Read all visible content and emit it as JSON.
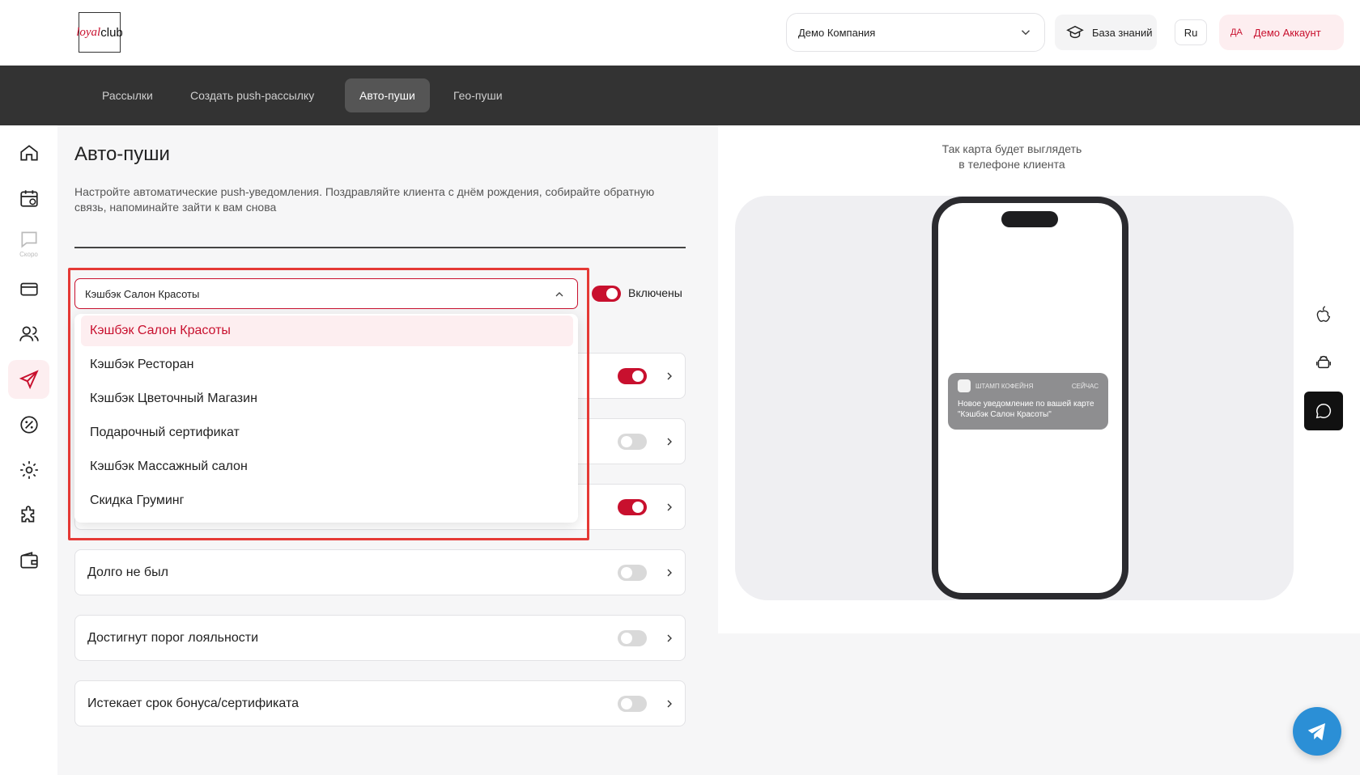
{
  "header": {
    "logo_part1": "loyal",
    "logo_part2": "club",
    "company": "Демо Компания",
    "knowledge_base": "База знаний",
    "language": "Ru",
    "account_initials": "ДА",
    "account_name": "Демо Аккаунт"
  },
  "nav": {
    "tabs": [
      {
        "label": "Рассылки"
      },
      {
        "label": "Создать push-рассылку"
      },
      {
        "label": "Авто-пуши",
        "active": true
      },
      {
        "label": "Гео-пуши"
      }
    ]
  },
  "rail": {
    "items": [
      {
        "icon": "home-icon"
      },
      {
        "icon": "calendar-icon"
      },
      {
        "icon": "chat-icon",
        "note": "Скоро"
      },
      {
        "icon": "card-icon"
      },
      {
        "icon": "users-icon"
      },
      {
        "icon": "send-icon",
        "active": true
      },
      {
        "icon": "percent-icon"
      },
      {
        "icon": "gear-icon"
      },
      {
        "icon": "puzzle-icon"
      },
      {
        "icon": "wallet-icon"
      }
    ]
  },
  "main": {
    "title": "Авто-пуши",
    "description": "Настройте автоматические push-уведомления. Поздравляйте клиента с днём рождения, собирайте обратную связь, напоминайте зайти к вам снова",
    "selected_card": "Кэшбэк Салон Красоты",
    "enabled_label": "Включены",
    "master_toggle_on": true,
    "rows": [
      {
        "label": "",
        "on": true
      },
      {
        "label": "",
        "on": false
      },
      {
        "label": "",
        "on": true
      },
      {
        "label": "Долго не был",
        "on": false
      },
      {
        "label": "Достигнут порог лояльности",
        "on": false
      },
      {
        "label": "Истекает срок бонуса/сертификата",
        "on": false
      }
    ]
  },
  "dropdown": {
    "options": [
      {
        "label": "Кэшбэк Салон Красоты",
        "selected": true
      },
      {
        "label": "Кэшбэк Ресторан"
      },
      {
        "label": "Кэшбэк Цветочный Магазин"
      },
      {
        "label": "Подарочный сертификат"
      },
      {
        "label": "Кэшбэк Массажный салон"
      },
      {
        "label": "Скидка Груминг"
      }
    ]
  },
  "preview": {
    "caption_line1": "Так карта будет выглядеть",
    "caption_line2": "в телефоне клиента",
    "notification": {
      "app": "ШТАМП КОФЕЙНЯ",
      "time": "СЕЙЧАС",
      "text": "Новое уведомление по вашей карте \"Кэшбэк Салон Красоты\""
    }
  },
  "colors": {
    "accent": "#c8102e",
    "navbar": "#333333",
    "telegram": "#2b8fd6"
  }
}
